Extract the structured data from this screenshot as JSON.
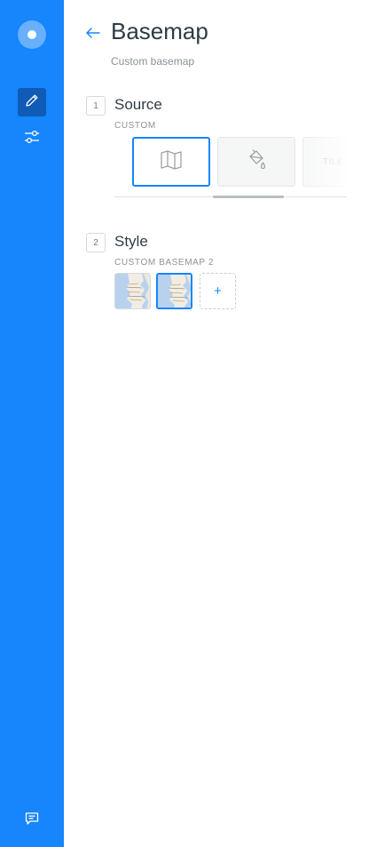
{
  "sidebar": {
    "items": [
      {
        "name": "logo",
        "icon": "circle-logo-icon"
      },
      {
        "name": "edit",
        "icon": "pencil-icon",
        "active": true
      },
      {
        "name": "settings",
        "icon": "sliders-icon",
        "active": false
      },
      {
        "name": "feedback",
        "icon": "chat-icon"
      }
    ],
    "color": "#1785fb",
    "active_color": "#0f5bb5"
  },
  "header": {
    "back_icon": "arrow-left-icon",
    "title": "Basemap",
    "subtitle": "Custom basemap"
  },
  "steps": {
    "source": {
      "number": "1",
      "title": "Source",
      "label": "CUSTOM",
      "options": [
        {
          "name": "map",
          "icon": "map-icon",
          "selected": true
        },
        {
          "name": "fill",
          "icon": "paint-bucket-icon",
          "selected": false
        },
        {
          "name": "tiles",
          "label": "TILE",
          "selected": false
        }
      ]
    },
    "style": {
      "number": "2",
      "title": "Style",
      "label": "CUSTOM BASEMAP 2",
      "thumbnails": [
        {
          "name": "custom-basemap-1",
          "selected": false
        },
        {
          "name": "custom-basemap-2",
          "selected": true
        }
      ],
      "add_label": "+"
    }
  },
  "accent_color": "#1785fb"
}
